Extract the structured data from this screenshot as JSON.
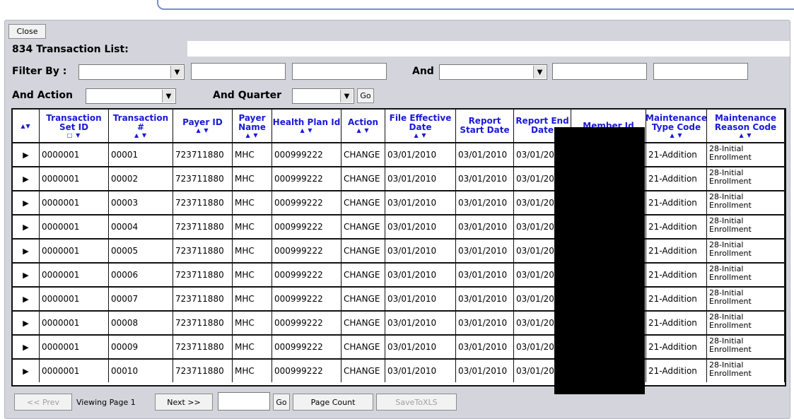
{
  "window": {
    "close_label": "Close"
  },
  "header": {
    "title": "834 Transaction List:"
  },
  "filter": {
    "filter_by_label": "Filter By :",
    "and_label": "And",
    "and_action_label": "And Action",
    "and_quarter_label": "And Quarter",
    "go_label": "Go"
  },
  "columns": [
    {
      "label": "",
      "sort": "▲▼"
    },
    {
      "label": "Transaction Set ID",
      "sort": "□ ▼"
    },
    {
      "label": "Transaction #",
      "sort": "▲ ▼"
    },
    {
      "label": "Payer ID",
      "sort": "▲ ▼"
    },
    {
      "label": "Payer Name",
      "sort": "▲ ▼"
    },
    {
      "label": "Health Plan Id",
      "sort": "▲ ▼"
    },
    {
      "label": "Action",
      "sort": "▲ ▼"
    },
    {
      "label": "File Effective Date",
      "sort": "▲ ▼"
    },
    {
      "label": "Report Start Date",
      "sort": ""
    },
    {
      "label": "Report End Date",
      "sort": ""
    },
    {
      "label": "Member Id",
      "sort": ""
    },
    {
      "label": "Maintenance Type Code",
      "sort": "▲ ▼"
    },
    {
      "label": "Maintenance Reason Code",
      "sort": "▲ ▼"
    }
  ],
  "rows": [
    {
      "set_id": "0000001",
      "txn": "00001",
      "payer_id": "723711880",
      "payer_name": "MHC",
      "plan_id": "000999222",
      "action": "CHANGE",
      "file_date": "03/01/2010",
      "start_date": "03/01/2010",
      "end_date": "03/01/201",
      "type_code": "21-Addition",
      "reason_code": "28-Initial Enrollment"
    },
    {
      "set_id": "0000001",
      "txn": "00002",
      "payer_id": "723711880",
      "payer_name": "MHC",
      "plan_id": "000999222",
      "action": "CHANGE",
      "file_date": "03/01/2010",
      "start_date": "03/01/2010",
      "end_date": "03/01/201",
      "type_code": "21-Addition",
      "reason_code": "28-Initial Enrollment"
    },
    {
      "set_id": "0000001",
      "txn": "00003",
      "payer_id": "723711880",
      "payer_name": "MHC",
      "plan_id": "000999222",
      "action": "CHANGE",
      "file_date": "03/01/2010",
      "start_date": "03/01/2010",
      "end_date": "03/01/201",
      "type_code": "21-Addition",
      "reason_code": "28-Initial Enrollment"
    },
    {
      "set_id": "0000001",
      "txn": "00004",
      "payer_id": "723711880",
      "payer_name": "MHC",
      "plan_id": "000999222",
      "action": "CHANGE",
      "file_date": "03/01/2010",
      "start_date": "03/01/2010",
      "end_date": "03/01/201",
      "type_code": "21-Addition",
      "reason_code": "28-Initial Enrollment"
    },
    {
      "set_id": "0000001",
      "txn": "00005",
      "payer_id": "723711880",
      "payer_name": "MHC",
      "plan_id": "000999222",
      "action": "CHANGE",
      "file_date": "03/01/2010",
      "start_date": "03/01/2010",
      "end_date": "03/01/201",
      "type_code": "21-Addition",
      "reason_code": "28-Initial Enrollment"
    },
    {
      "set_id": "0000001",
      "txn": "00006",
      "payer_id": "723711880",
      "payer_name": "MHC",
      "plan_id": "000999222",
      "action": "CHANGE",
      "file_date": "03/01/2010",
      "start_date": "03/01/2010",
      "end_date": "03/01/201",
      "type_code": "21-Addition",
      "reason_code": "28-Initial Enrollment"
    },
    {
      "set_id": "0000001",
      "txn": "00007",
      "payer_id": "723711880",
      "payer_name": "MHC",
      "plan_id": "000999222",
      "action": "CHANGE",
      "file_date": "03/01/2010",
      "start_date": "03/01/2010",
      "end_date": "03/01/201",
      "type_code": "21-Addition",
      "reason_code": "28-Initial Enrollment"
    },
    {
      "set_id": "0000001",
      "txn": "00008",
      "payer_id": "723711880",
      "payer_name": "MHC",
      "plan_id": "000999222",
      "action": "CHANGE",
      "file_date": "03/01/2010",
      "start_date": "03/01/2010",
      "end_date": "03/01/201",
      "type_code": "21-Addition",
      "reason_code": "28-Initial Enrollment"
    },
    {
      "set_id": "0000001",
      "txn": "00009",
      "payer_id": "723711880",
      "payer_name": "MHC",
      "plan_id": "000999222",
      "action": "CHANGE",
      "file_date": "03/01/2010",
      "start_date": "03/01/2010",
      "end_date": "03/01/201",
      "type_code": "21-Addition",
      "reason_code": "28-Initial Enrollment"
    },
    {
      "set_id": "0000001",
      "txn": "00010",
      "payer_id": "723711880",
      "payer_name": "MHC",
      "plan_id": "000999222",
      "action": "CHANGE",
      "file_date": "03/01/2010",
      "start_date": "03/01/2010",
      "end_date": "03/01/201",
      "type_code": "21-Addition",
      "reason_code": "28-Initial Enrollment"
    }
  ],
  "row_selector_glyph": "▶",
  "pager": {
    "prev_label": "<< Prev",
    "viewing_label": "Viewing Page 1",
    "next_label": "Next >>",
    "go_label": "Go",
    "page_count_label": "Page Count",
    "save_xls_label": "SaveToXLS"
  }
}
